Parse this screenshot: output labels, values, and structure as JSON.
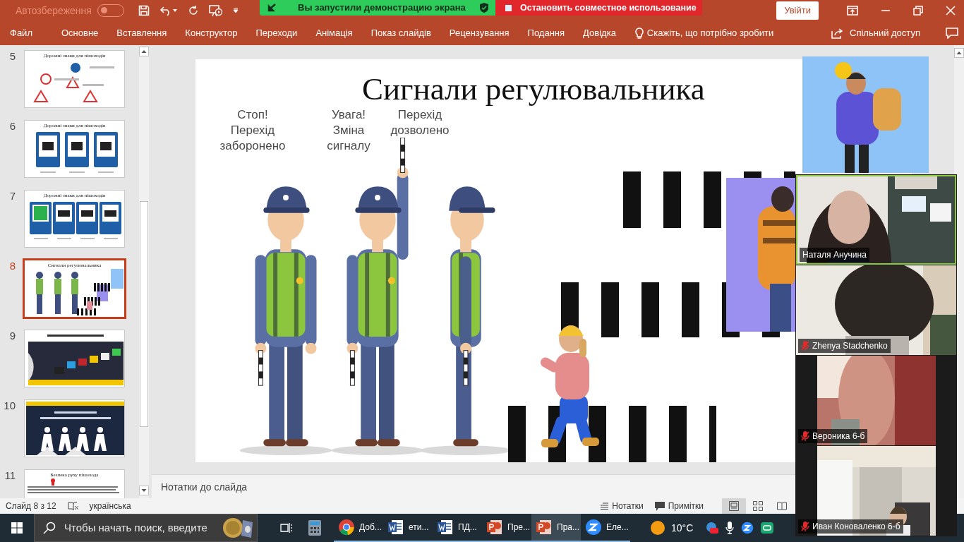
{
  "title_bar": {
    "autosave_label": "Автозбереження",
    "autosave_on": false,
    "sign_in": "Увійти"
  },
  "share_banner": {
    "status": "Вы запустили демонстрацию экрана",
    "stop": "Остановить совместное использование"
  },
  "ribbon_tabs": [
    "Файл",
    "Основне",
    "Вставлення",
    "Конструктор",
    "Переходи",
    "Анімація",
    "Показ слайдів",
    "Рецензування",
    "Подання",
    "Довідка"
  ],
  "tell_me": "Скажіть, що потрібно зробити",
  "share": "Спільний доступ",
  "slides": [
    {
      "number": "5",
      "title": "Дорожні знаки для пішоходів",
      "selected": false
    },
    {
      "number": "6",
      "title": "Дорожні знаки для пішоходів",
      "selected": false
    },
    {
      "number": "7",
      "title": "Дорожні знаки для пішоходів",
      "selected": false
    },
    {
      "number": "8",
      "title": "Сигнали регулювальника",
      "selected": true
    },
    {
      "number": "9",
      "selected": false
    },
    {
      "number": "10",
      "selected": false
    },
    {
      "number": "11",
      "title": "Безпека руху пішохода",
      "selected": false
    }
  ],
  "slide": {
    "title": "Сигнали регулювальника",
    "signals": [
      {
        "label": "Стоп! Перехід заборонено",
        "kind": "down"
      },
      {
        "label": "Увага! Зміна сигналу",
        "kind": "raised"
      },
      {
        "label": "Перехід дозволено",
        "kind": "side"
      }
    ]
  },
  "notes_placeholder": "Нотатки до слайда",
  "status_bar": {
    "slide": "Слайд 8 з 12",
    "language": "українська",
    "notes": "Нотатки",
    "comments": "Примітки"
  },
  "taskbar": {
    "search_placeholder": "Чтобы начать поиск, введите",
    "apps": [
      {
        "label": "Доб...",
        "kind": "chrome",
        "selected": false
      },
      {
        "label": "ети...",
        "kind": "word",
        "selected": false
      },
      {
        "label": "ПД...",
        "kind": "word",
        "selected": false
      },
      {
        "label": "Пре...",
        "kind": "powerpoint",
        "selected": false
      },
      {
        "label": "Пра...",
        "kind": "powerpoint",
        "selected": true
      },
      {
        "label": "Еле...",
        "kind": "zoom",
        "selected": false
      }
    ],
    "weather": "10°C"
  },
  "video_tiles": [
    {
      "name": "Наталя Анучина",
      "muted": false,
      "active": true,
      "kind": "wide"
    },
    {
      "name": "Zhenya Stadchenko",
      "muted": true,
      "active": false,
      "kind": "wide"
    },
    {
      "name": "Вероника 6-б",
      "muted": true,
      "active": false,
      "kind": "narrow"
    },
    {
      "name": "Иван Коноваленко 6-б",
      "muted": true,
      "active": false,
      "kind": "narrow"
    }
  ]
}
